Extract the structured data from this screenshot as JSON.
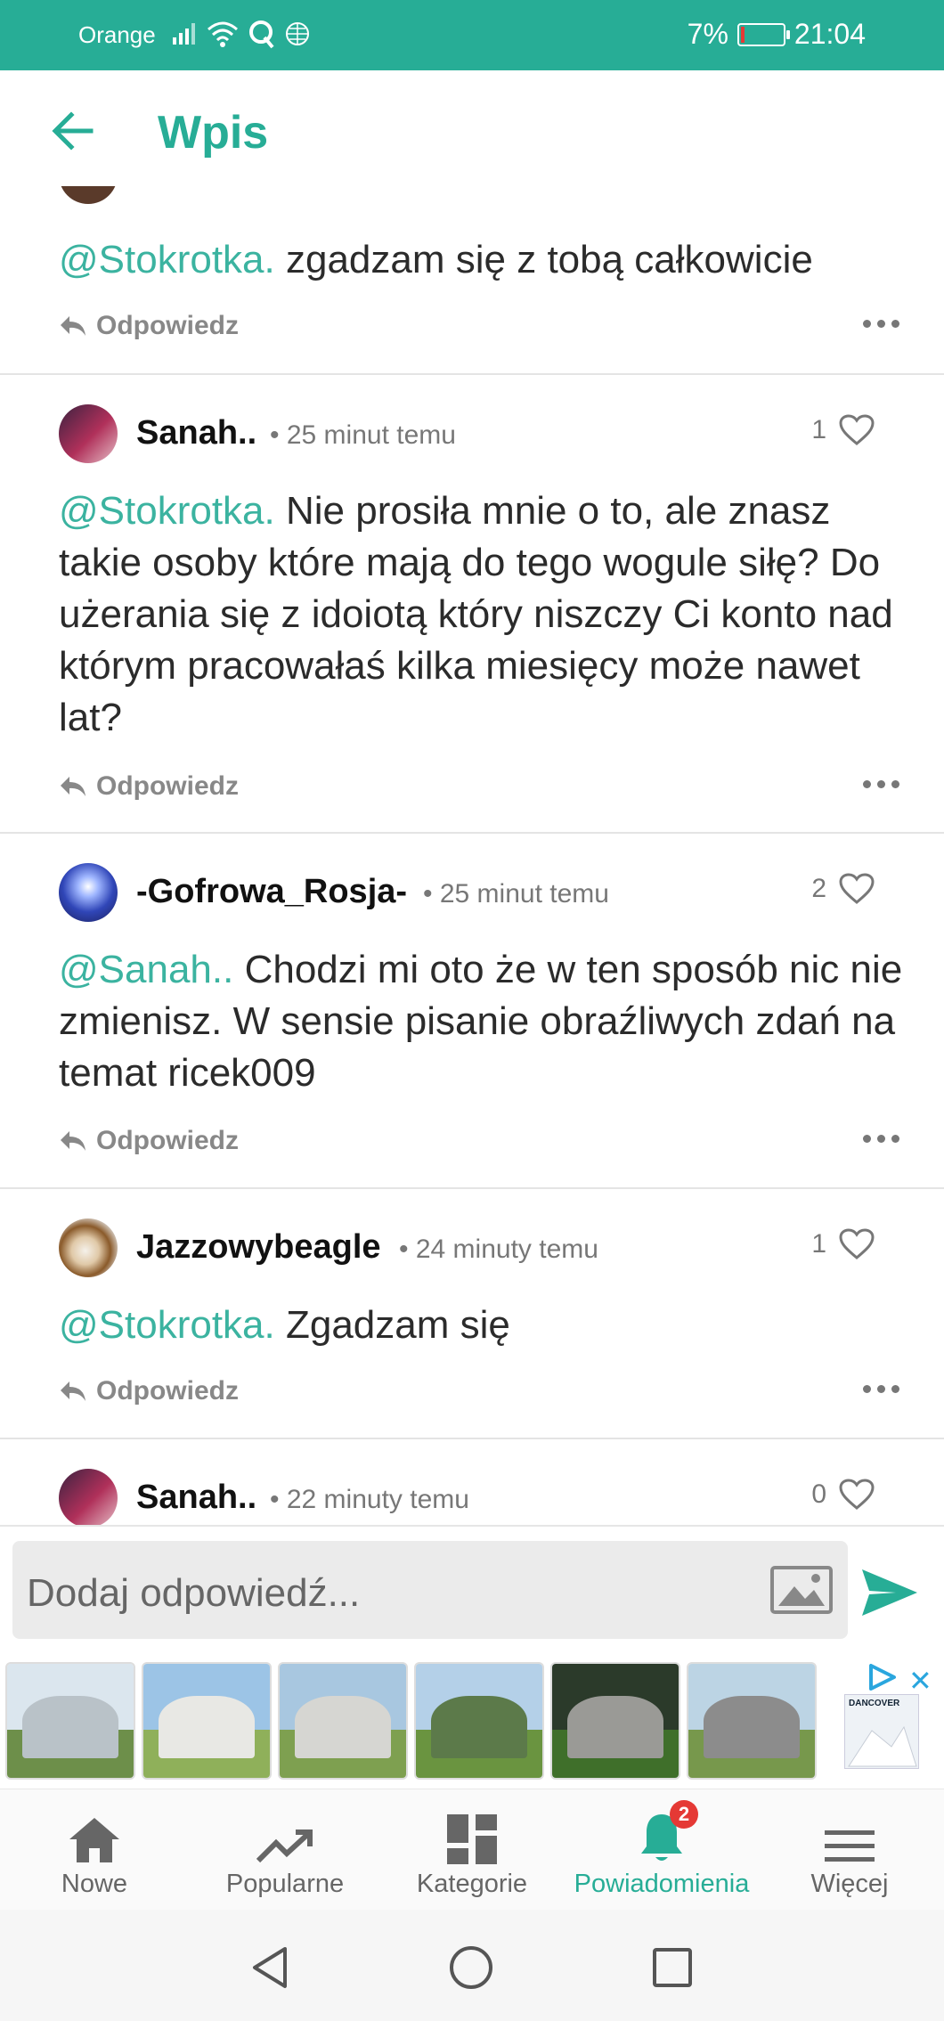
{
  "status_bar": {
    "carrier": "Orange",
    "battery": "7%",
    "time": "21:04"
  },
  "app_bar": {
    "title": "Wpis"
  },
  "colors": {
    "accent": "#27ad96",
    "mention": "#3bb3a0",
    "badge": "#e53935"
  },
  "top_partial_comment": {
    "mention": "@Stokrotka.",
    "text": " zgadzam się z tobą całkowicie",
    "reply_label": "Odpowiedz"
  },
  "comments": [
    {
      "username": "Sanah..",
      "time": "• 25 minut temu",
      "likes": "1",
      "mention": "@Stokrotka.",
      "text": " Nie prosiła mnie o to, ale znasz takie osoby które mają do tego wogule siłę? Do użerania się z idoiotą który niszczy Ci konto nad którym pracowałaś kilka miesięcy może nawet lat?",
      "reply_label": "Odpowiedz"
    },
    {
      "username": "-Gofrowa_Rosja-",
      "time": "• 25 minut temu",
      "likes": "2",
      "mention": "@Sanah..",
      "text": " Chodzi mi oto że w ten sposób nic nie zmienisz. W sensie pisanie obraźliwych zdań na temat ricek009",
      "reply_label": "Odpowiedz"
    },
    {
      "username": "Jazzowybeagle",
      "time": "• 24 minuty temu",
      "likes": "1",
      "mention": "@Stokrotka.",
      "text": " Zgadzam się",
      "reply_label": "Odpowiedz"
    },
    {
      "username": "Sanah..",
      "time": "• 22 minuty temu",
      "likes": "0"
    }
  ],
  "composer": {
    "placeholder": "Dodaj odpowiedź..."
  },
  "ad": {
    "brand": "DANCOVER"
  },
  "bottom_nav": [
    {
      "label": "Nowe",
      "icon": "home-icon"
    },
    {
      "label": "Popularne",
      "icon": "trending-icon"
    },
    {
      "label": "Kategorie",
      "icon": "dashboard-icon"
    },
    {
      "label": "Powiadomienia",
      "icon": "bell-icon",
      "badge": "2",
      "active": true
    },
    {
      "label": "Więcej",
      "icon": "menu-icon"
    }
  ]
}
